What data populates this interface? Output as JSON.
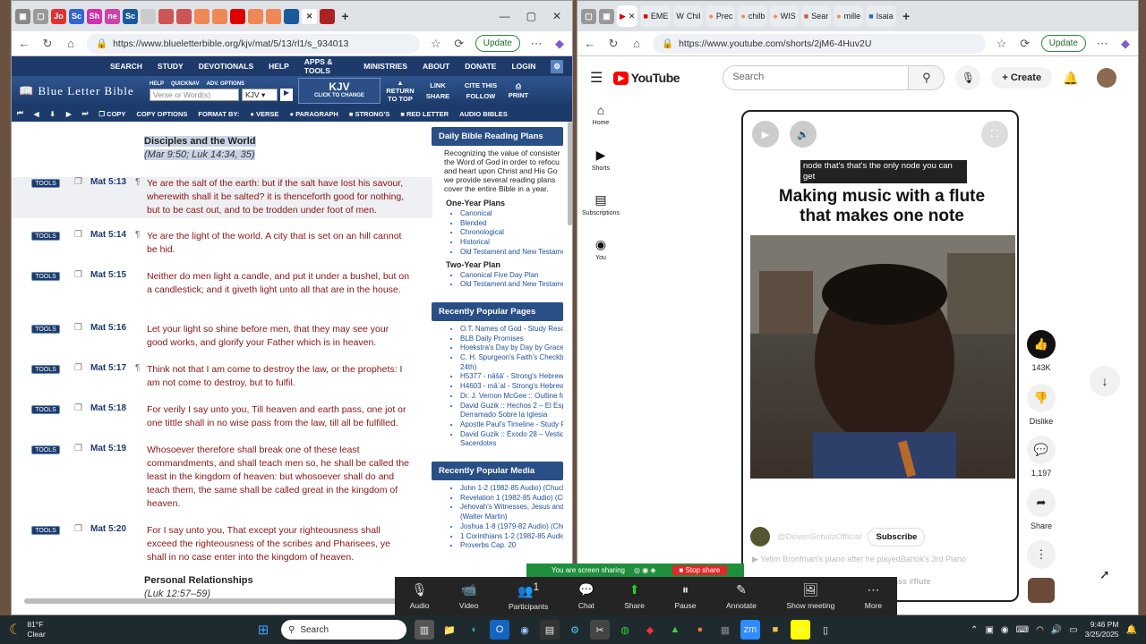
{
  "left": {
    "tabs": [
      "Jo",
      "Sc",
      "Sh",
      "ne",
      "Sc"
    ],
    "url": "https://www.blueletterbible.org/kjv/mat/5/13/rl1/s_934013",
    "update": "Update",
    "nav": [
      "SEARCH",
      "STUDY",
      "DEVOTIONALS",
      "HELP",
      "APPS & TOOLS",
      "MINISTRIES",
      "ABOUT",
      "DONATE"
    ],
    "login": "LOGIN",
    "logo": "Blue Letter Bible",
    "search_placeholder": "Verse or Word(s)",
    "version": "KJV",
    "kjv": "KJV",
    "kjv_sub": "CLICK TO CHANGE",
    "links": [
      "HELP",
      "QUICKNAV",
      "ADV. OPTIONS"
    ],
    "return": "RETURN TO TOP",
    "link": "LINK",
    "share": "SHARE",
    "cite": "CITE THIS",
    "follow": "FOLLOW",
    "print": "PRINT",
    "toolbar": [
      "COPY",
      "COPY OPTIONS",
      "FORMAT BY:",
      "VERSE",
      "PARAGRAPH",
      "STRONG'S",
      "RED LETTER",
      "AUDIO BIBLES"
    ],
    "section1": "Disciples and the World",
    "section1_ref": "(Mar 9:50; Luk 14:34, 35)",
    "verses": [
      {
        "ref": "Mat 5:13",
        "text": "Ye are the salt of the earth: but if the salt have lost his savour, wherewith shall it be salted? it is thenceforth good for nothing, but to be cast out, and to be trodden under foot of men."
      },
      {
        "ref": "Mat 5:14",
        "text": "Ye are the light of the world. A city that is set on an hill cannot be hid."
      },
      {
        "ref": "Mat 5:15",
        "text": "Neither do men light a candle, and put it under a bushel, but on a candlestick; and it giveth light unto all that are in the house."
      },
      {
        "ref": "Mat 5:16",
        "text": "Let your light so shine before men, that they may see your good works, and glorify your Father which is in heaven."
      },
      {
        "ref": "Mat 5:17",
        "text": "Think not that I am come to destroy the law, or the prophets: I am not come to destroy, but to fulfil."
      },
      {
        "ref": "Mat 5:18",
        "text": "For verily I say unto you, Till heaven and earth pass, one jot or one tittle shall in no wise pass from the law, till all be fulfilled."
      },
      {
        "ref": "Mat 5:19",
        "text": "Whosoever therefore shall break one of these least commandments, and shall teach men so, he shall be called the least in the kingdom of heaven: but whosoever shall do and teach them, the same shall be called great in the kingdom of heaven."
      },
      {
        "ref": "Mat 5:20",
        "text": "For I say unto you, That except your righteousness shall exceed the righteousness of the scribes and Pharisees, ye shall in no case enter into the kingdom of heaven."
      }
    ],
    "tools": "TOOLS",
    "section2": "Personal Relationships",
    "section2_ref": "(Luk 12:57–59)",
    "sidebar": {
      "dbrp": "Daily Bible Reading Plans",
      "intro": [
        "Recognizing the value of consister",
        "the Word of God in order to refocu",
        "and heart upon Christ and His Go",
        "we provide several reading plans",
        "cover the entire Bible in a year."
      ],
      "one_year": "One-Year Plans",
      "one_year_items": [
        "Canonical",
        "Blended",
        "Chronological",
        "Historical",
        "Old Testament and New Testame"
      ],
      "two_year": "Two-Year Plan",
      "two_year_items": [
        "Canonical Five Day Plan",
        "Old Testament and New Testame"
      ],
      "pages": "Recently Popular Pages",
      "pages_items": [
        "O.T. Names of God - Study Reso",
        "BLB Daily Promises",
        "Hoekstra's Day by Day by Grace",
        "C. H. Spurgeon's Faith's Checkb",
        "24th)",
        "H5377 - nāšā' - Strong's Hebrew",
        "H4603 - mā`al - Strong's Hebrew",
        "Dr. J. Vernon McGee :: Outline fo",
        "David Guzik :: Hechos 2 – El Esp",
        "Derramado Sobre la Iglesia",
        "Apostle Paul's Timeline - Study R",
        "David Guzik :: Éxodo 28 – Vestid",
        "Sacerdotes"
      ],
      "media": "Recently Popular Media",
      "media_items": [
        "John 1-2 (1982-85 Audio) (Chuck",
        "Revelation 1 (1982-85 Audio) (Ch",
        "Jehovah's Witnesses, Jesus and",
        "(Walter Martin)",
        "Joshua 1-8 (1979-82 Audio) (Chu",
        "1 Corinthians 1-2 (1982-85 Audio",
        "Proverbs Cap. 20"
      ]
    }
  },
  "right": {
    "tabs": [
      "EME",
      "Chil",
      "Prec",
      "chilb",
      "WIS",
      "Sear",
      "mille",
      "Isaia"
    ],
    "url": "https://www.youtube.com/shorts/2jM6-4Huv2U",
    "update": "Update",
    "logo": "YouTube",
    "search_placeholder": "Search",
    "create": "Create",
    "nav": [
      "Home",
      "Shorts",
      "Subscriptions",
      "You"
    ],
    "caption": "node that's that's the only node you can get",
    "title": "Making music with a flute that makes one note",
    "channel": "@DevenSchulzOfficial",
    "subscribe": "Subscribe",
    "desc": "Yefim Bronfman's piano after he playedBartók's 3rd Piano",
    "tag": "#brass #flute",
    "likes": "143K",
    "dislike": "Dislike",
    "comments": "1,197",
    "share": "Share"
  },
  "zoom": {
    "sharing": "You are screen sharing",
    "stop": "Stop share",
    "items": [
      "Audio",
      "Video",
      "Participants",
      "Chat",
      "Share",
      "Pause",
      "Annotate",
      "Show meeting",
      "More"
    ],
    "participants_count": "1"
  },
  "taskbar": {
    "temp": "81°F",
    "weather": "Clear",
    "search": "Search",
    "time": "9:46 PM",
    "date": "3/25/2025"
  }
}
